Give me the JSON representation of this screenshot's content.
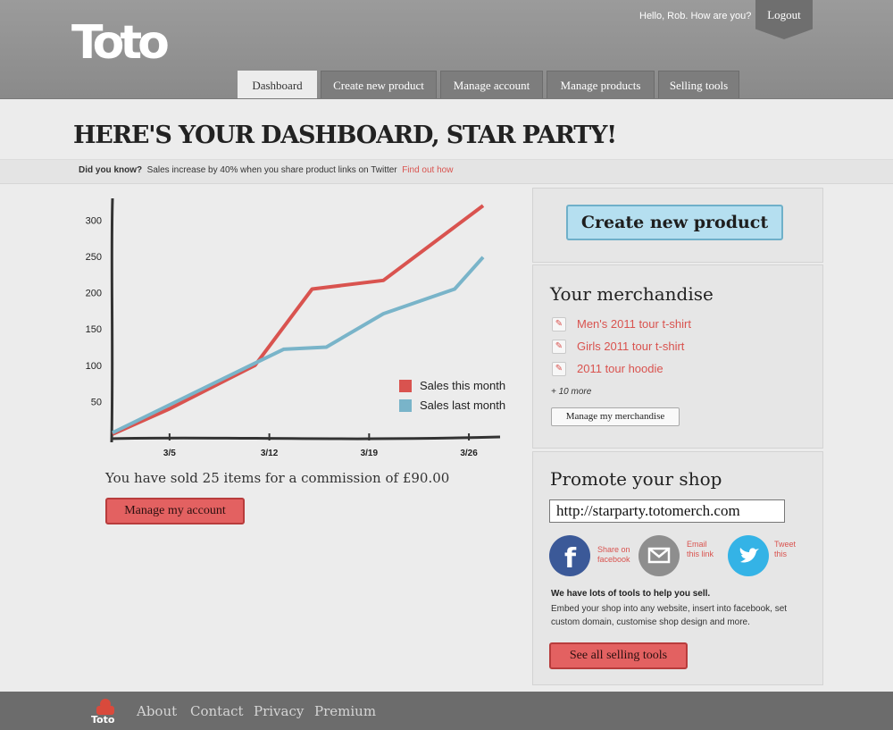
{
  "brand": {
    "logo_text": "Toto",
    "footer_logo_text": "Toto"
  },
  "header": {
    "greeting": "Hello, Rob.  How are you?",
    "logout_label": "Logout",
    "tabs": [
      {
        "label": "Dashboard",
        "active": true
      },
      {
        "label": "Create new product",
        "active": false
      },
      {
        "label": "Manage account",
        "active": false
      },
      {
        "label": "Manage products",
        "active": false
      },
      {
        "label": "Selling tools",
        "active": false
      }
    ]
  },
  "page": {
    "title": "HERE'S YOUR DASHBOARD, STAR PARTY!"
  },
  "tip": {
    "lead": "Did you know?",
    "text": "Sales increase by 40% when you share product links on Twitter",
    "link": "Find out how"
  },
  "chart_data": {
    "type": "line",
    "title": "",
    "xlabel": "",
    "ylabel": "",
    "x": [
      1,
      5,
      11,
      13,
      15,
      17,
      21,
      23,
      27
    ],
    "x_ticks": [
      {
        "value": 5,
        "label": "3/5"
      },
      {
        "value": 12,
        "label": "3/12"
      },
      {
        "value": 19,
        "label": "3/19"
      },
      {
        "value": 26,
        "label": "3/26"
      }
    ],
    "y_ticks": [
      50,
      100,
      150,
      200,
      250,
      300
    ],
    "xlim": [
      1,
      28
    ],
    "ylim": [
      0,
      330
    ],
    "series": [
      {
        "name": "Sales this month",
        "color": "#d9534f",
        "points": [
          [
            1,
            5
          ],
          [
            5,
            40
          ],
          [
            11,
            100
          ],
          [
            15,
            205
          ],
          [
            20,
            217
          ],
          [
            27,
            320
          ]
        ]
      },
      {
        "name": "Sales last month",
        "color": "#79b4c9",
        "points": [
          [
            1,
            7
          ],
          [
            11,
            103
          ],
          [
            13,
            122
          ],
          [
            16,
            125
          ],
          [
            20,
            171
          ],
          [
            25,
            205
          ],
          [
            27,
            249
          ]
        ]
      }
    ],
    "legend": "bottom-right",
    "grid": false
  },
  "summary": {
    "sold_text": "You have sold 25 items for a commission of £90.00",
    "manage_account_label": "Manage my account"
  },
  "sidebar": {
    "create_label": "Create new product",
    "merch": {
      "title": "Your merchandise",
      "items": [
        "Men's 2011 tour t-shirt",
        "Girls 2011 tour t-shirt",
        "2011 tour hoodie"
      ],
      "more": "+ 10 more",
      "manage_label": "Manage my merchandise"
    },
    "promote": {
      "title": "Promote your shop",
      "url": "http://starparty.totomerch.com",
      "share": [
        {
          "label1": "Share on",
          "label2": "facebook",
          "icon": "facebook-icon",
          "color": "#3b5998"
        },
        {
          "label1": "Email",
          "label2": "this link",
          "icon": "email-icon",
          "color": "#8e8e8e"
        },
        {
          "label1": "Tweet",
          "label2": "this",
          "icon": "twitter-icon",
          "color": "#34b3e6"
        }
      ],
      "tools_bold": "We have lots of tools to help you sell.",
      "tools_text": "Embed your shop into any website, insert into facebook, set custom domain, customise shop design and more.",
      "tools_button": "See all selling tools"
    }
  },
  "footer": {
    "links": [
      "About",
      "Contact",
      "Privacy",
      "Premium"
    ]
  }
}
